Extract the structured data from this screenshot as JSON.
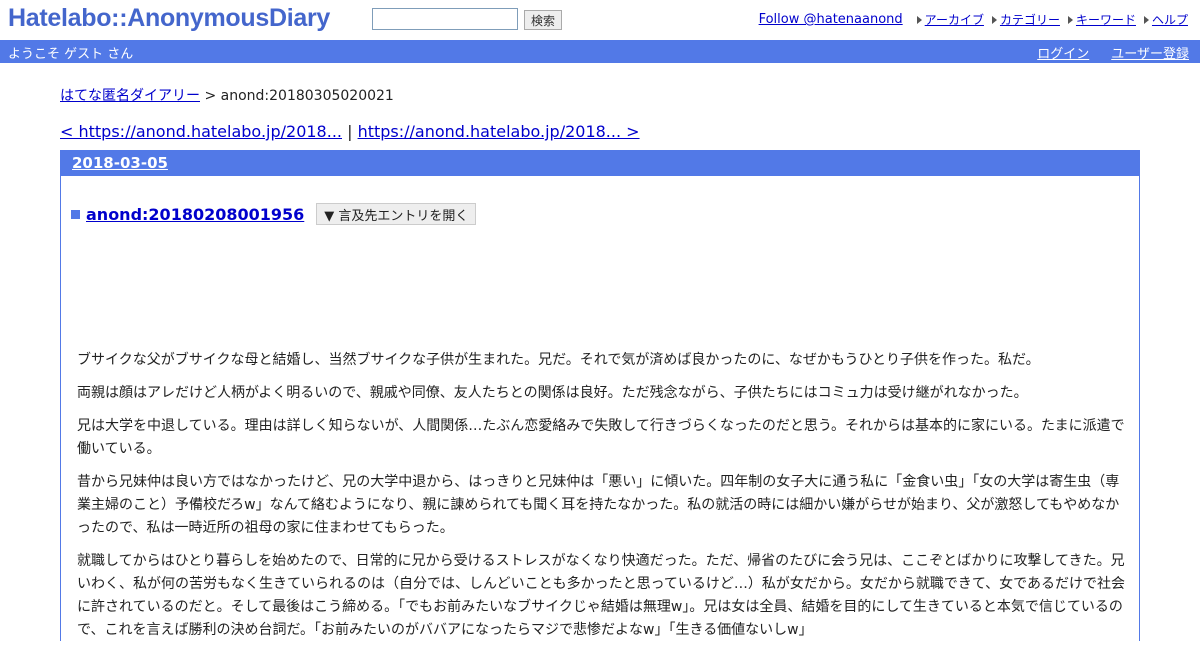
{
  "header": {
    "logo": "Hatelabo::AnonymousDiary",
    "search_button": "検索",
    "search_value": "",
    "follow": "Follow @hatenaanond",
    "nav": [
      "アーカイブ",
      "カテゴリー",
      "キーワード",
      "ヘルプ"
    ]
  },
  "welcome": {
    "text": "ようこそ ゲスト さん",
    "login": "ログイン",
    "register": "ユーザー登録"
  },
  "breadcrumb": {
    "home": "はてな匿名ダイアリー",
    "sep": " > ",
    "current": "anond:20180305020021"
  },
  "pager": {
    "prev": "< https://anond.hatelabo.jp/2018...",
    "sep": " | ",
    "next": "https://anond.hatelabo.jp/2018... >"
  },
  "day": {
    "date": "2018-03-05",
    "section_title": "anond:20180208001956",
    "expand_button": "▼ 言及先エントリを開く",
    "paragraphs": [
      "ブサイクな父がブサイクな母と結婚し、当然ブサイクな子供が生まれた。兄だ。それで気が済めば良かったのに、なぜかもうひとり子供を作った。私だ。",
      "両親は顔はアレだけど人柄がよく明るいので、親戚や同僚、友人たちとの関係は良好。ただ残念ながら、子供たちにはコミュ力は受け継がれなかった。",
      "兄は大学を中退している。理由は詳しく知らないが、人間関係…たぶん恋愛絡みで失敗して行きづらくなったのだと思う。それからは基本的に家にいる。たまに派遣で働いている。",
      "昔から兄妹仲は良い方ではなかったけど、兄の大学中退から、はっきりと兄妹仲は「悪い」に傾いた。四年制の女子大に通う私に「金食い虫」「女の大学は寄生虫（専業主婦のこと）予備校だろw」なんて絡むようになり、親に諌められても聞く耳を持たなかった。私の就活の時には細かい嫌がらせが始まり、父が激怒してもやめなかったので、私は一時近所の祖母の家に住まわせてもらった。",
      "就職してからはひとり暮らしを始めたので、日常的に兄から受けるストレスがなくなり快適だった。ただ、帰省のたびに会う兄は、ここぞとばかりに攻撃してきた。兄いわく、私が何の苦労もなく生きていられるのは（自分では、しんどいことも多かったと思っているけど…）私が女だから。女だから就職できて、女であるだけで社会に許されているのだと。そして最後はこう締める。「でもお前みたいなブサイクじゃ結婚は無理w」。兄は女は全員、結婚を目的にして生きていると本気で信じているので、これを言えば勝利の決め台詞だ。「お前みたいのがババアになったらマジで悲惨だよなw」「生きる価値ないしw」"
    ]
  }
}
